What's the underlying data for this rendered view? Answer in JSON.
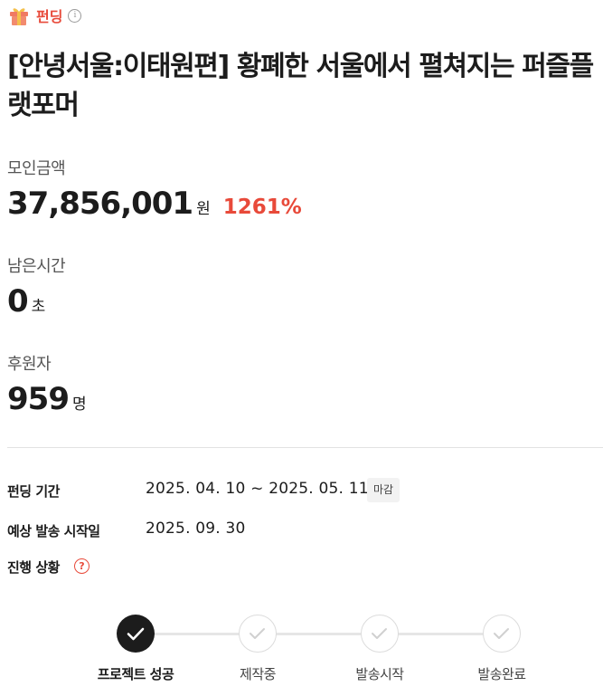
{
  "colors": {
    "accent": "#e84a3a",
    "text": "#1c1c1c",
    "muted": "#555555"
  },
  "category": {
    "icon": "gift-icon",
    "label": "펀딩",
    "info_icon": "info-icon",
    "info_glyph": "i"
  },
  "title": "[안녕서울:이태원편] 황폐한 서울에서 펼쳐지는 퍼즐플랫포머",
  "stats": {
    "raised": {
      "label": "모인금액",
      "value": "37,856,001",
      "unit": "원",
      "rate": "1261%"
    },
    "remaining": {
      "label": "남은시간",
      "value": "0",
      "unit": "초"
    },
    "backers": {
      "label": "후원자",
      "value": "959",
      "unit": "명"
    }
  },
  "info": {
    "period": {
      "label": "펀딩 기간",
      "value": "2025. 04. 10 ~ 2025. 05. 11",
      "badge": "마감"
    },
    "shipping": {
      "label": "예상 발송 시작일",
      "value": "2025. 09. 30"
    },
    "progress": {
      "label": "진행 상황",
      "help_icon": "help-icon",
      "help_glyph": "?"
    }
  },
  "steps": [
    {
      "label": "프로젝트 성공",
      "state": "done"
    },
    {
      "label": "제작중",
      "state": "todo"
    },
    {
      "label": "발송시작",
      "state": "todo"
    },
    {
      "label": "발송완료",
      "state": "todo"
    }
  ]
}
